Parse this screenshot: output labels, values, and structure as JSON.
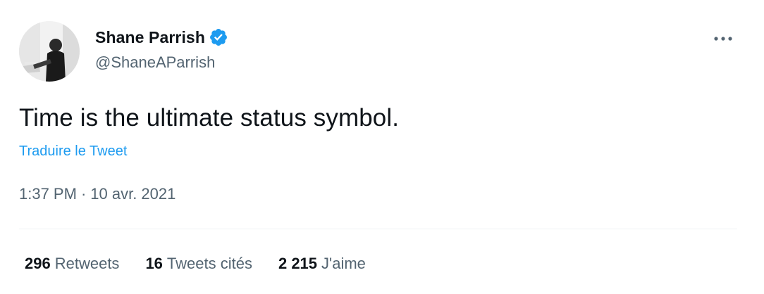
{
  "tweet": {
    "author": {
      "name": "Shane Parrish",
      "handle": "@ShaneAParrish",
      "verified": true,
      "avatar_icon": "profile-photo"
    },
    "text": "Time is the ultimate status symbol.",
    "translate_label": "Traduire le Tweet",
    "time": "1:37 PM",
    "separator": "·",
    "date": "10 avr. 2021",
    "stats": [
      {
        "count": "296",
        "label": "Retweets"
      },
      {
        "count": "16",
        "label": "Tweets cités"
      },
      {
        "count": "2 215",
        "label": "J'aime"
      }
    ],
    "more_icon": "more-horizontal-icon"
  },
  "colors": {
    "primary_text": "#0f1419",
    "secondary_text": "#536471",
    "link": "#1d9bf0",
    "verified_badge": "#1d9bf0",
    "divider": "#eff3f4"
  }
}
